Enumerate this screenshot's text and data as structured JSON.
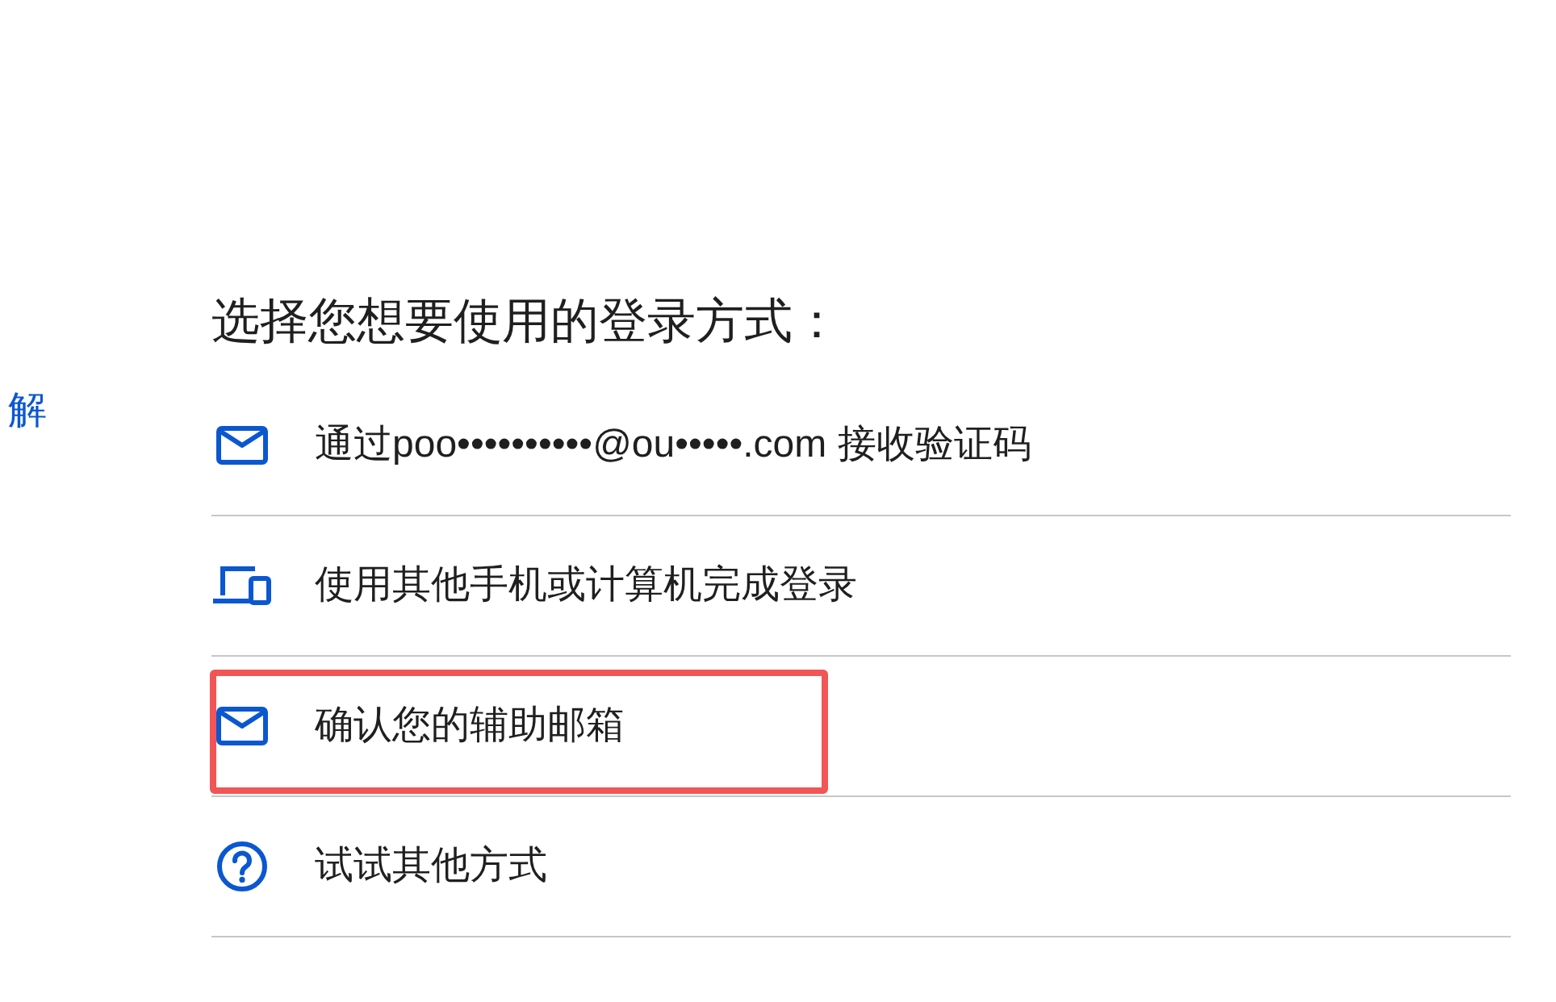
{
  "side_link": {
    "text": "解"
  },
  "title": "选择您想要使用的登录方式：",
  "options": [
    {
      "kind": "email",
      "label": "通过poo••••••••••@ou•••••.com 接收验证码",
      "highlighted": false
    },
    {
      "kind": "devices",
      "label": "使用其他手机或计算机完成登录",
      "highlighted": false
    },
    {
      "kind": "email",
      "label": "确认您的辅助邮箱",
      "highlighted": true
    },
    {
      "kind": "help",
      "label": "试试其他方式",
      "highlighted": false
    }
  ]
}
